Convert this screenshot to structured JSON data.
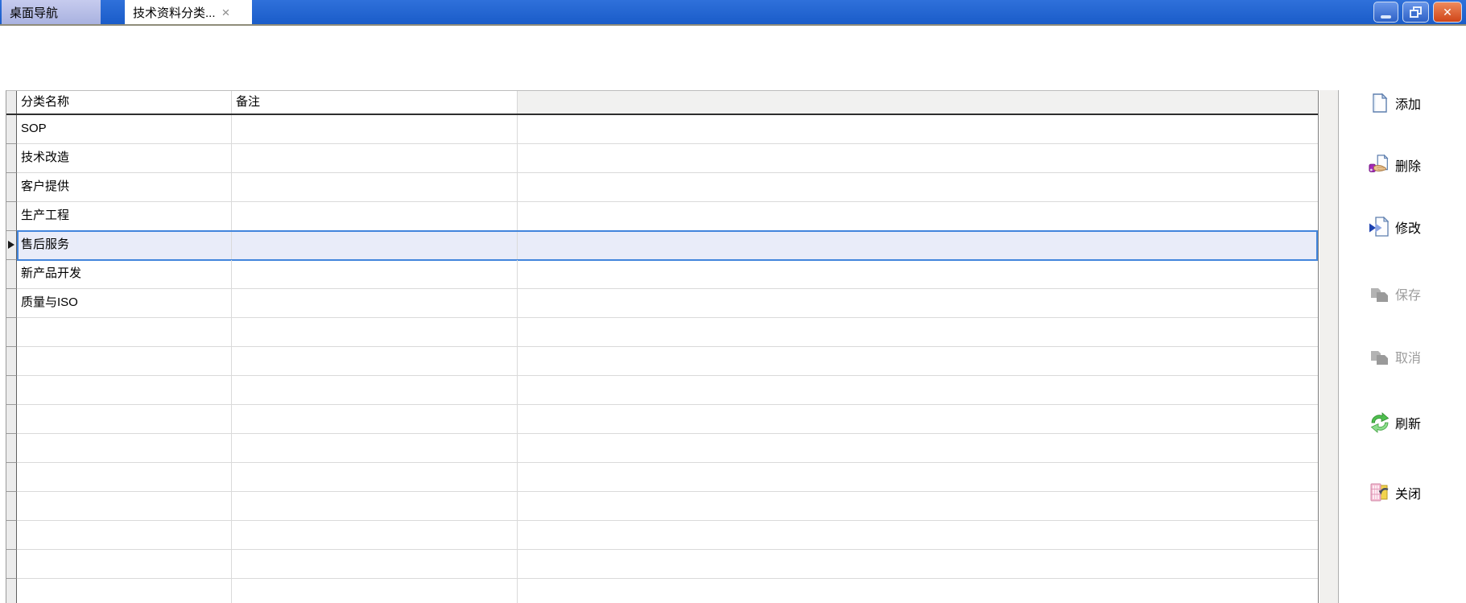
{
  "titlebar": {
    "tabs": [
      {
        "label": "桌面导航"
      },
      {
        "label": "技术资料分类...",
        "close_glyph": "×"
      }
    ],
    "window_controls": {
      "close_glyph": "✕"
    }
  },
  "table": {
    "columns": [
      "分类名称",
      "备注"
    ],
    "rows": [
      {
        "name": "SOP",
        "note": ""
      },
      {
        "name": "技术改造",
        "note": ""
      },
      {
        "name": "客户提供",
        "note": ""
      },
      {
        "name": "生产工程",
        "note": ""
      },
      {
        "name": "售后服务",
        "note": ""
      },
      {
        "name": "新产品开发",
        "note": ""
      },
      {
        "name": "质量与ISO",
        "note": ""
      }
    ],
    "selected_index": 4,
    "empty_row_count": 10
  },
  "actions": [
    {
      "label": "添加",
      "icon": "add-document-icon",
      "enabled": true
    },
    {
      "label": "删除",
      "icon": "delete-hand-icon",
      "enabled": true
    },
    {
      "label": "修改",
      "icon": "modify-document-icon",
      "enabled": true
    },
    {
      "label": "保存",
      "icon": "save-icon",
      "enabled": false
    },
    {
      "label": "取消",
      "icon": "cancel-icon",
      "enabled": false
    },
    {
      "label": "刷新",
      "icon": "refresh-icon",
      "enabled": true
    },
    {
      "label": "关闭",
      "icon": "close-exit-icon",
      "enabled": true
    }
  ],
  "colors": {
    "titlebar_blue": "#1e63d0",
    "inactive_tab": "#b9c0e8",
    "close_button_red": "#d9542f",
    "selection_fill": "#e9ecf9",
    "selection_border": "#4285dc",
    "disabled_text": "#9d9d9d",
    "refresh_green": "#4fbf4f"
  }
}
